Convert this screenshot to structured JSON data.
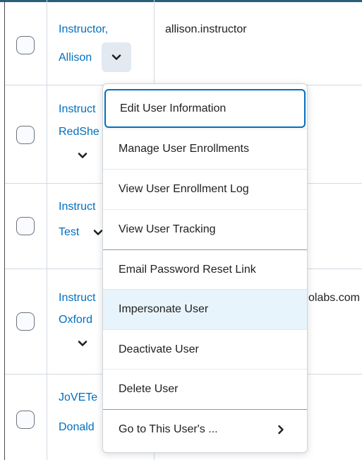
{
  "rows": [
    {
      "name_line1": "Instructor,",
      "name_line2": "Allison",
      "login": "allison.instructor"
    },
    {
      "name_line1": "Instruct",
      "name_line2": "RedShe"
    },
    {
      "name_line1": "Instruct",
      "name_line2": "Test"
    },
    {
      "name_line1": "Instruct",
      "name_line2": "Oxford",
      "email_fragment": "olabs.com"
    },
    {
      "name_line1": "JoVETe",
      "name_line2": "Donald"
    }
  ],
  "context_menu": {
    "items": [
      {
        "label": "Edit User Information"
      },
      {
        "label": "Manage User Enrollments"
      },
      {
        "label": "View User Enrollment Log"
      },
      {
        "label": "View User Tracking"
      },
      {
        "label": "Email Password Reset Link"
      },
      {
        "label": "Impersonate User"
      },
      {
        "label": "Deactivate User"
      },
      {
        "label": "Delete User"
      },
      {
        "label": "Go to This User's ..."
      }
    ]
  },
  "colors": {
    "link": "#006fbf",
    "focus_outline": "#006fbf",
    "hover_bg": "#e8f4fb",
    "grid_line": "#d3d9e3",
    "top_bar": "#2b5d7c"
  }
}
